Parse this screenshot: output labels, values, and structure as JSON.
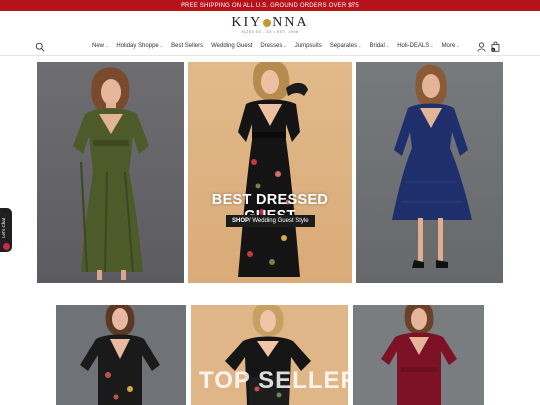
{
  "promo": {
    "text": "FREE SHIPPING ON ALL U.S. GROUND ORDERS OVER $75",
    "prev": "‹",
    "next": "›"
  },
  "brand": {
    "name_left": "KIY",
    "name_right": "NNA",
    "tagline": "SIZES 0X - 5X • EST. 1996",
    "accent": "#c8962e"
  },
  "nav": {
    "items": [
      {
        "label": "New",
        "dropdown": true
      },
      {
        "label": "Holiday Shoppe",
        "dropdown": true
      },
      {
        "label": "Best Sellers",
        "dropdown": false
      },
      {
        "label": "Wedding Guest",
        "dropdown": false
      },
      {
        "label": "Dresses",
        "dropdown": true
      },
      {
        "label": "Jumpsuits",
        "dropdown": false
      },
      {
        "label": "Separates",
        "dropdown": true
      },
      {
        "label": "Bridal",
        "dropdown": true
      },
      {
        "label": "Holi-DEALS",
        "dropdown": true
      },
      {
        "label": "More",
        "dropdown": true
      }
    ],
    "chevron": "⌄",
    "bag_count": "0"
  },
  "hero": {
    "headline": "BEST DRESSED GUEST",
    "shop_label": "SHOP",
    "shop_link": "/ Wedding Guest Style"
  },
  "tiles": {
    "overlay_text": "TOP SELLERS"
  },
  "side_tab": {
    "label": "Let's Chat"
  },
  "colors": {
    "promo_bg": "#b5121b",
    "dark": "#1c1c1c"
  }
}
